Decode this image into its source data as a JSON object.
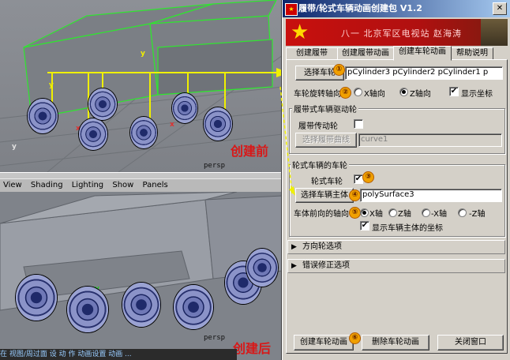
{
  "viewports": {
    "top_label": "persp",
    "bottom_label": "persp",
    "menu": [
      "View",
      "Shading",
      "Lighting",
      "Show",
      "Panels"
    ],
    "caption_before": "创建前",
    "caption_after": "创建后",
    "hint_text": "在 视图/周过面 设 动 作 动画设置 动画 ..."
  },
  "dialog": {
    "title": "履带/轮式车辆动画创建包 V1.2",
    "close_glyph": "✕",
    "banner_text": "八一  北京军区电视站 赵海涛",
    "banner_star": "★",
    "tabs": [
      "创建履带",
      "创建履带动画",
      "创建车轮动画",
      "帮助说明"
    ],
    "select_wheels_button": "选择车轮",
    "wheels_field": "pCylinder3 pCylinder2 pCylinder1 p",
    "rotation_axis_label": "车轮旋转轴向",
    "axis_options": [
      "X轴向",
      "Z轴向"
    ],
    "show_coords_label": "显示坐标",
    "track_group_title": "履带式车辆驱动轮",
    "track_drive_label": "履带传动轮",
    "load_track_curve_button": "选择履带曲线",
    "track_curve_field": "curve1",
    "wheeled_group_title": "轮式车辆的车轮",
    "wheeled_label": "轮式车轮",
    "select_body_button": "选择车辆主体",
    "body_field": "polySurface3",
    "forward_axis_label": "车体前向的轴向",
    "forward_options": [
      "X轴",
      "Z轴",
      "-X轴",
      "-Z轴"
    ],
    "show_body_coords_label": "显示车辆主体的坐标",
    "direction_section": "方向轮选项",
    "error_section": "错误修正选项",
    "create_button": "创建车轮动画",
    "delete_button": "删除车轮动画",
    "close_button": "关闭窗口",
    "badges": [
      "①",
      "②",
      "③",
      "④",
      "⑤",
      "⑥"
    ],
    "arrow_glyph": "▶",
    "check_glyph": "✔",
    "accent": "#f0a000"
  }
}
